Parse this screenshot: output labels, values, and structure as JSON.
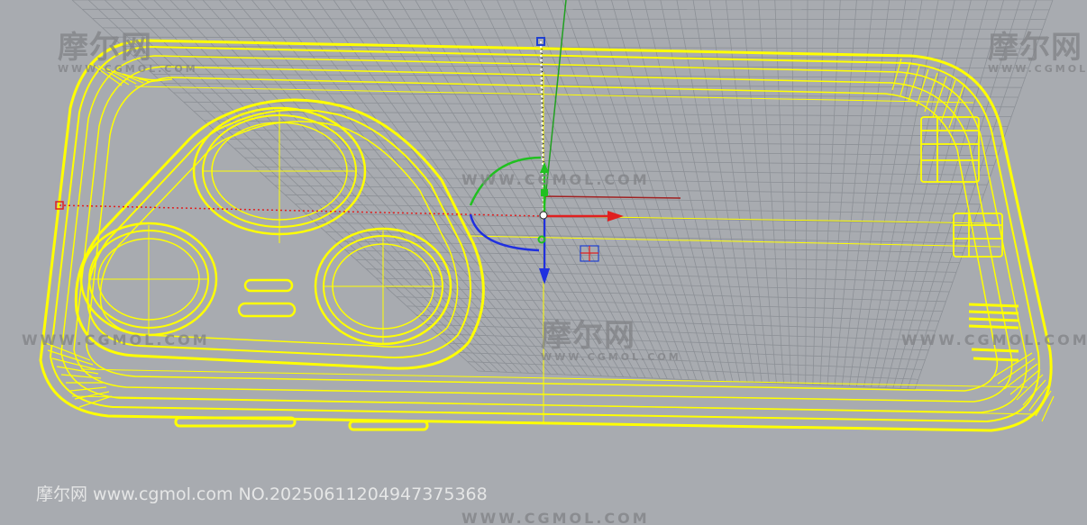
{
  "watermarks": {
    "logo_text": "摩尔网",
    "logo_sub": "WWW.CGMOL.COM",
    "url_text": "WWW.CGMOL.COM",
    "footer_stamp": "摩尔网 www.cgmol.com NO.20250611204947375368"
  },
  "colors": {
    "background": "#a8abb0",
    "grid": "#8c9096",
    "wireframe": "#ffff00",
    "axis_x": "#e02020",
    "axis_y": "#20c020",
    "axis_z": "#2030e0",
    "gumball_handle": "#2040d0"
  },
  "gizmo": {
    "icons": [
      "gumball-origin-icon",
      "rotate-arc-icon",
      "move-arrow-icon"
    ]
  }
}
